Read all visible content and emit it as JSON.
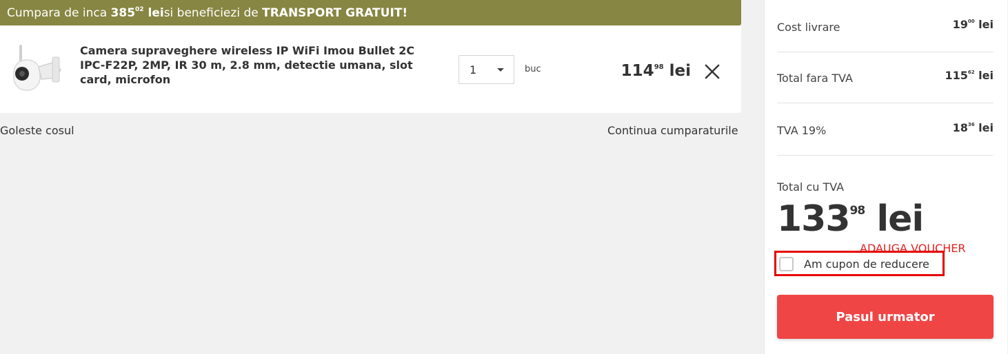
{
  "banner": {
    "prefix": "Cumpara de inca ",
    "amount_int": "385",
    "amount_dec": "02",
    "currency": "lei",
    "middle": " si beneficiezi de ",
    "highlight": "TRANSPORT GRATUIT!",
    "color": "#878642"
  },
  "cart_item": {
    "image_alt": "camera-product-image",
    "name": "Camera supraveghere wireless IP WiFi Imou Bullet 2C IPC-F22P, 2MP, IR 30 m, 2.8 mm, detectie umana, slot card, microfon",
    "quantity": "1",
    "unit": "buc",
    "price_int": "114",
    "price_dec": "98",
    "currency": "lei",
    "remove_icon": "close-icon"
  },
  "links": {
    "empty_cart": "Goleste cosul",
    "continue_shopping": "Continua cumparaturile"
  },
  "summary": {
    "rows": [
      {
        "label": "Cost livrare",
        "int": "19",
        "dec": "00",
        "currency": "lei"
      },
      {
        "label": "Total fara TVA",
        "int": "115",
        "dec": "62",
        "currency": "lei"
      },
      {
        "label": "TVA 19%",
        "int": "18",
        "dec": "36",
        "currency": "lei"
      }
    ],
    "total_label": "Total cu TVA",
    "total_int": "133",
    "total_dec": "98",
    "total_currency": "lei",
    "voucher_label": "ADAUGA VOUCHER",
    "coupon_label": "Am cupon de reducere",
    "next_button": "Pasul urmator",
    "button_color": "#f04545",
    "highlight_color": "#e60000"
  }
}
